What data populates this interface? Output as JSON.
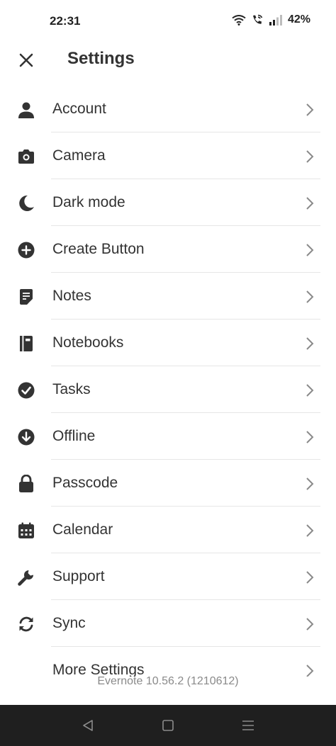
{
  "status_bar": {
    "time": "22:31",
    "battery": "42%",
    "icons": [
      "wifi-icon",
      "wifi-calling-icon",
      "signal-icon"
    ]
  },
  "header": {
    "title": "Settings",
    "close_icon": "close-icon"
  },
  "settings": [
    {
      "label": "Account",
      "icon": "person-icon"
    },
    {
      "label": "Camera",
      "icon": "camera-icon"
    },
    {
      "label": "Dark mode",
      "icon": "moon-icon"
    },
    {
      "label": "Create Button",
      "icon": "plus-circle-icon"
    },
    {
      "label": "Notes",
      "icon": "note-icon"
    },
    {
      "label": "Notebooks",
      "icon": "notebook-icon"
    },
    {
      "label": "Tasks",
      "icon": "check-circle-icon"
    },
    {
      "label": "Offline",
      "icon": "download-circle-icon"
    },
    {
      "label": "Passcode",
      "icon": "lock-icon"
    },
    {
      "label": "Calendar",
      "icon": "calendar-icon"
    },
    {
      "label": "Support",
      "icon": "wrench-icon"
    },
    {
      "label": "Sync",
      "icon": "sync-icon"
    },
    {
      "label": "More Settings",
      "icon": ""
    }
  ],
  "footer": {
    "version": "Evernote 10.56.2 (1210612)"
  },
  "nav_bar": {
    "buttons": [
      "back-icon",
      "home-icon",
      "menu-icon"
    ]
  },
  "colors": {
    "text": "#333333",
    "icon": "#333333",
    "chevron": "#8a8a8a",
    "divider": "#e6e6e6",
    "version_text": "#8a8a8a",
    "nav_bar_bg": "#1f1f1f"
  }
}
